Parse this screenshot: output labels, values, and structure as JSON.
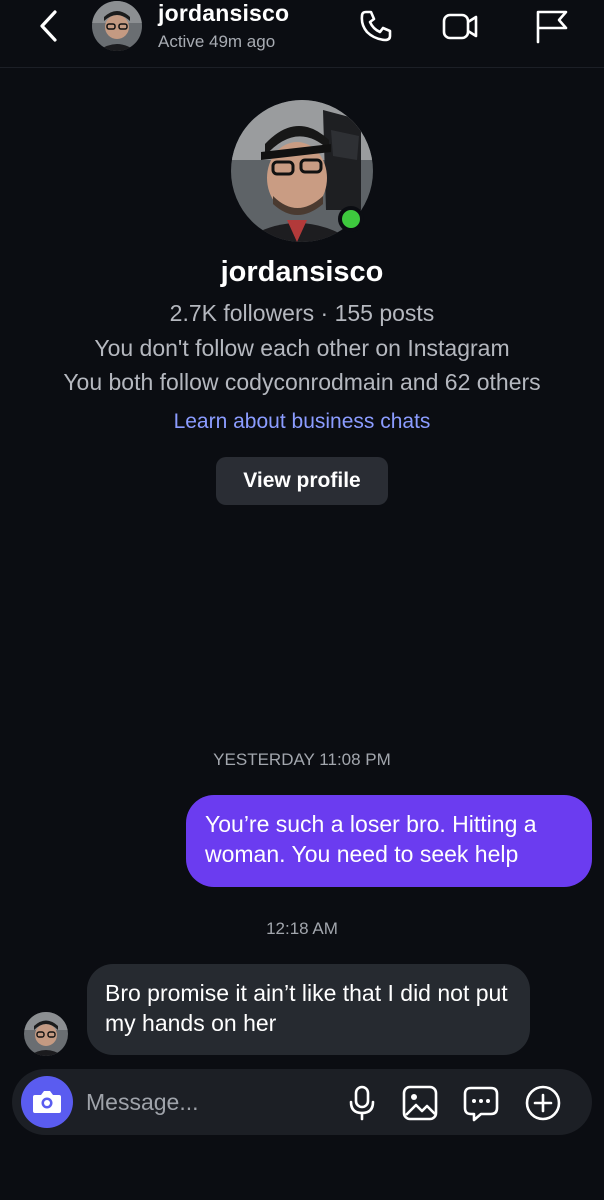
{
  "header": {
    "username": "jordansisco",
    "status": "Active 49m ago"
  },
  "profile": {
    "username": "jordansisco",
    "stats": "2.7K followers · 155 posts",
    "follow_status": "You don't follow each other on Instagram",
    "mutuals": "You both follow codyconrodmain and 62 others",
    "business_link": "Learn about business chats",
    "view_profile_label": "View profile"
  },
  "messages": [
    {
      "timestamp": "YESTERDAY 11:08 PM",
      "direction": "outgoing",
      "text": "You’re such a loser bro. Hitting a woman. You need to seek help"
    },
    {
      "timestamp": "12:18 AM",
      "direction": "incoming",
      "text": "Bro promise it ain’t like that I did not put my hands on her"
    }
  ],
  "composer": {
    "placeholder": "Message..."
  },
  "colors": {
    "background": "#0b0d12",
    "outgoing_bubble": "#6b3cf0",
    "incoming_bubble": "#262a30",
    "link": "#8b9cff",
    "online": "#3ec93e",
    "camera_button": "#5a5cf0"
  },
  "icons": [
    "chevron-left-icon",
    "phone-icon",
    "video-camera-icon",
    "flag-icon",
    "camera-icon",
    "microphone-icon",
    "image-icon",
    "sticker-chat-icon",
    "plus-circle-icon"
  ]
}
